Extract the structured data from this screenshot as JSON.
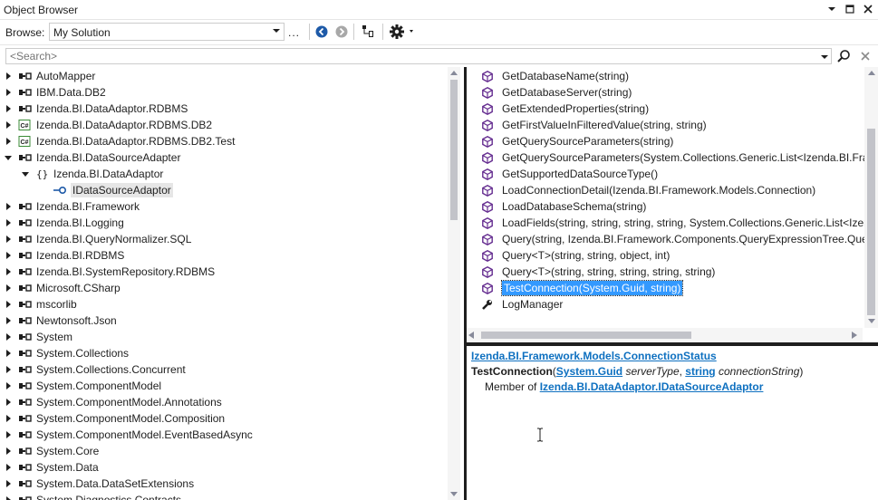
{
  "window": {
    "title": "Object Browser"
  },
  "toolbar": {
    "browse_label": "Browse:",
    "browse_value": "My Solution",
    "more_label": "..."
  },
  "search": {
    "placeholder": "<Search>"
  },
  "tree": [
    {
      "label": "AutoMapper",
      "icon": "assembly",
      "expander": "collapsed",
      "indent": 0
    },
    {
      "label": "IBM.Data.DB2",
      "icon": "assembly",
      "expander": "collapsed",
      "indent": 0
    },
    {
      "label": "Izenda.BI.DataAdaptor.RDBMS",
      "icon": "assembly",
      "expander": "collapsed",
      "indent": 0
    },
    {
      "label": "Izenda.BI.DataAdaptor.RDBMS.DB2",
      "icon": "csharp-project",
      "expander": "collapsed",
      "indent": 0
    },
    {
      "label": "Izenda.BI.DataAdaptor.RDBMS.DB2.Test",
      "icon": "csharp-project",
      "expander": "collapsed",
      "indent": 0
    },
    {
      "label": "Izenda.BI.DataSourceAdapter",
      "icon": "assembly",
      "expander": "expanded",
      "indent": 0
    },
    {
      "label": "Izenda.BI.DataAdaptor",
      "icon": "namespace",
      "expander": "expanded",
      "indent": 1
    },
    {
      "label": "IDataSourceAdaptor",
      "icon": "interface",
      "expander": "none",
      "indent": 2,
      "selected": true
    },
    {
      "label": "Izenda.BI.Framework",
      "icon": "assembly",
      "expander": "collapsed",
      "indent": 0
    },
    {
      "label": "Izenda.BI.Logging",
      "icon": "assembly",
      "expander": "collapsed",
      "indent": 0
    },
    {
      "label": "Izenda.BI.QueryNormalizer.SQL",
      "icon": "assembly",
      "expander": "collapsed",
      "indent": 0
    },
    {
      "label": "Izenda.BI.RDBMS",
      "icon": "assembly",
      "expander": "collapsed",
      "indent": 0
    },
    {
      "label": "Izenda.BI.SystemRepository.RDBMS",
      "icon": "assembly",
      "expander": "collapsed",
      "indent": 0
    },
    {
      "label": "Microsoft.CSharp",
      "icon": "assembly",
      "expander": "collapsed",
      "indent": 0
    },
    {
      "label": "mscorlib",
      "icon": "assembly",
      "expander": "collapsed",
      "indent": 0
    },
    {
      "label": "Newtonsoft.Json",
      "icon": "assembly",
      "expander": "collapsed",
      "indent": 0
    },
    {
      "label": "System",
      "icon": "assembly",
      "expander": "collapsed",
      "indent": 0
    },
    {
      "label": "System.Collections",
      "icon": "assembly",
      "expander": "collapsed",
      "indent": 0
    },
    {
      "label": "System.Collections.Concurrent",
      "icon": "assembly",
      "expander": "collapsed",
      "indent": 0
    },
    {
      "label": "System.ComponentModel",
      "icon": "assembly",
      "expander": "collapsed",
      "indent": 0
    },
    {
      "label": "System.ComponentModel.Annotations",
      "icon": "assembly",
      "expander": "collapsed",
      "indent": 0
    },
    {
      "label": "System.ComponentModel.Composition",
      "icon": "assembly",
      "expander": "collapsed",
      "indent": 0
    },
    {
      "label": "System.ComponentModel.EventBasedAsync",
      "icon": "assembly",
      "expander": "collapsed",
      "indent": 0
    },
    {
      "label": "System.Core",
      "icon": "assembly",
      "expander": "collapsed",
      "indent": 0
    },
    {
      "label": "System.Data",
      "icon": "assembly",
      "expander": "collapsed",
      "indent": 0
    },
    {
      "label": "System.Data.DataSetExtensions",
      "icon": "assembly",
      "expander": "collapsed",
      "indent": 0
    },
    {
      "label": "System.Diagnostics.Contracts",
      "icon": "assembly",
      "expander": "collapsed",
      "indent": 0
    }
  ],
  "members": [
    {
      "label": "GetDatabaseName(string)",
      "icon": "method"
    },
    {
      "label": "GetDatabaseServer(string)",
      "icon": "method"
    },
    {
      "label": "GetExtendedProperties(string)",
      "icon": "method"
    },
    {
      "label": "GetFirstValueInFilteredValue(string, string)",
      "icon": "method"
    },
    {
      "label": "GetQuerySourceParameters(string)",
      "icon": "method"
    },
    {
      "label": "GetQuerySourceParameters(System.Collections.Generic.List<Izenda.BI.Fram",
      "icon": "method"
    },
    {
      "label": "GetSupportedDataSourceType()",
      "icon": "method"
    },
    {
      "label": "LoadConnectionDetail(Izenda.BI.Framework.Models.Connection)",
      "icon": "method"
    },
    {
      "label": "LoadDatabaseSchema(string)",
      "icon": "method"
    },
    {
      "label": "LoadFields(string, string, string, string, System.Collections.Generic.List<Izen",
      "icon": "method"
    },
    {
      "label": "Query(string, Izenda.BI.Framework.Components.QueryExpressionTree.Query",
      "icon": "method"
    },
    {
      "label": "Query<T>(string, string, object, int)",
      "icon": "method"
    },
    {
      "label": "Query<T>(string, string, string, string, string)",
      "icon": "method"
    },
    {
      "label": "TestConnection(System.Guid, string)",
      "icon": "method",
      "selected": true
    },
    {
      "label": "LogManager",
      "icon": "property"
    }
  ],
  "description": {
    "return_type": "Izenda.BI.Framework.Models.ConnectionStatus",
    "method_name": "TestConnection",
    "open_paren": "(",
    "param1_type": "System.Guid",
    "param1_name": "serverType",
    "comma": ", ",
    "param2_type": "string",
    "param2_name": "connectionString",
    "close_paren": ")",
    "member_of_label": "Member of",
    "member_of_link": "Izenda.BI.DataAdaptor.IDataSourceAdaptor"
  },
  "colors": {
    "accent": "#0e70c0",
    "selection": "#3399ff",
    "method_icon": "#652d90"
  }
}
